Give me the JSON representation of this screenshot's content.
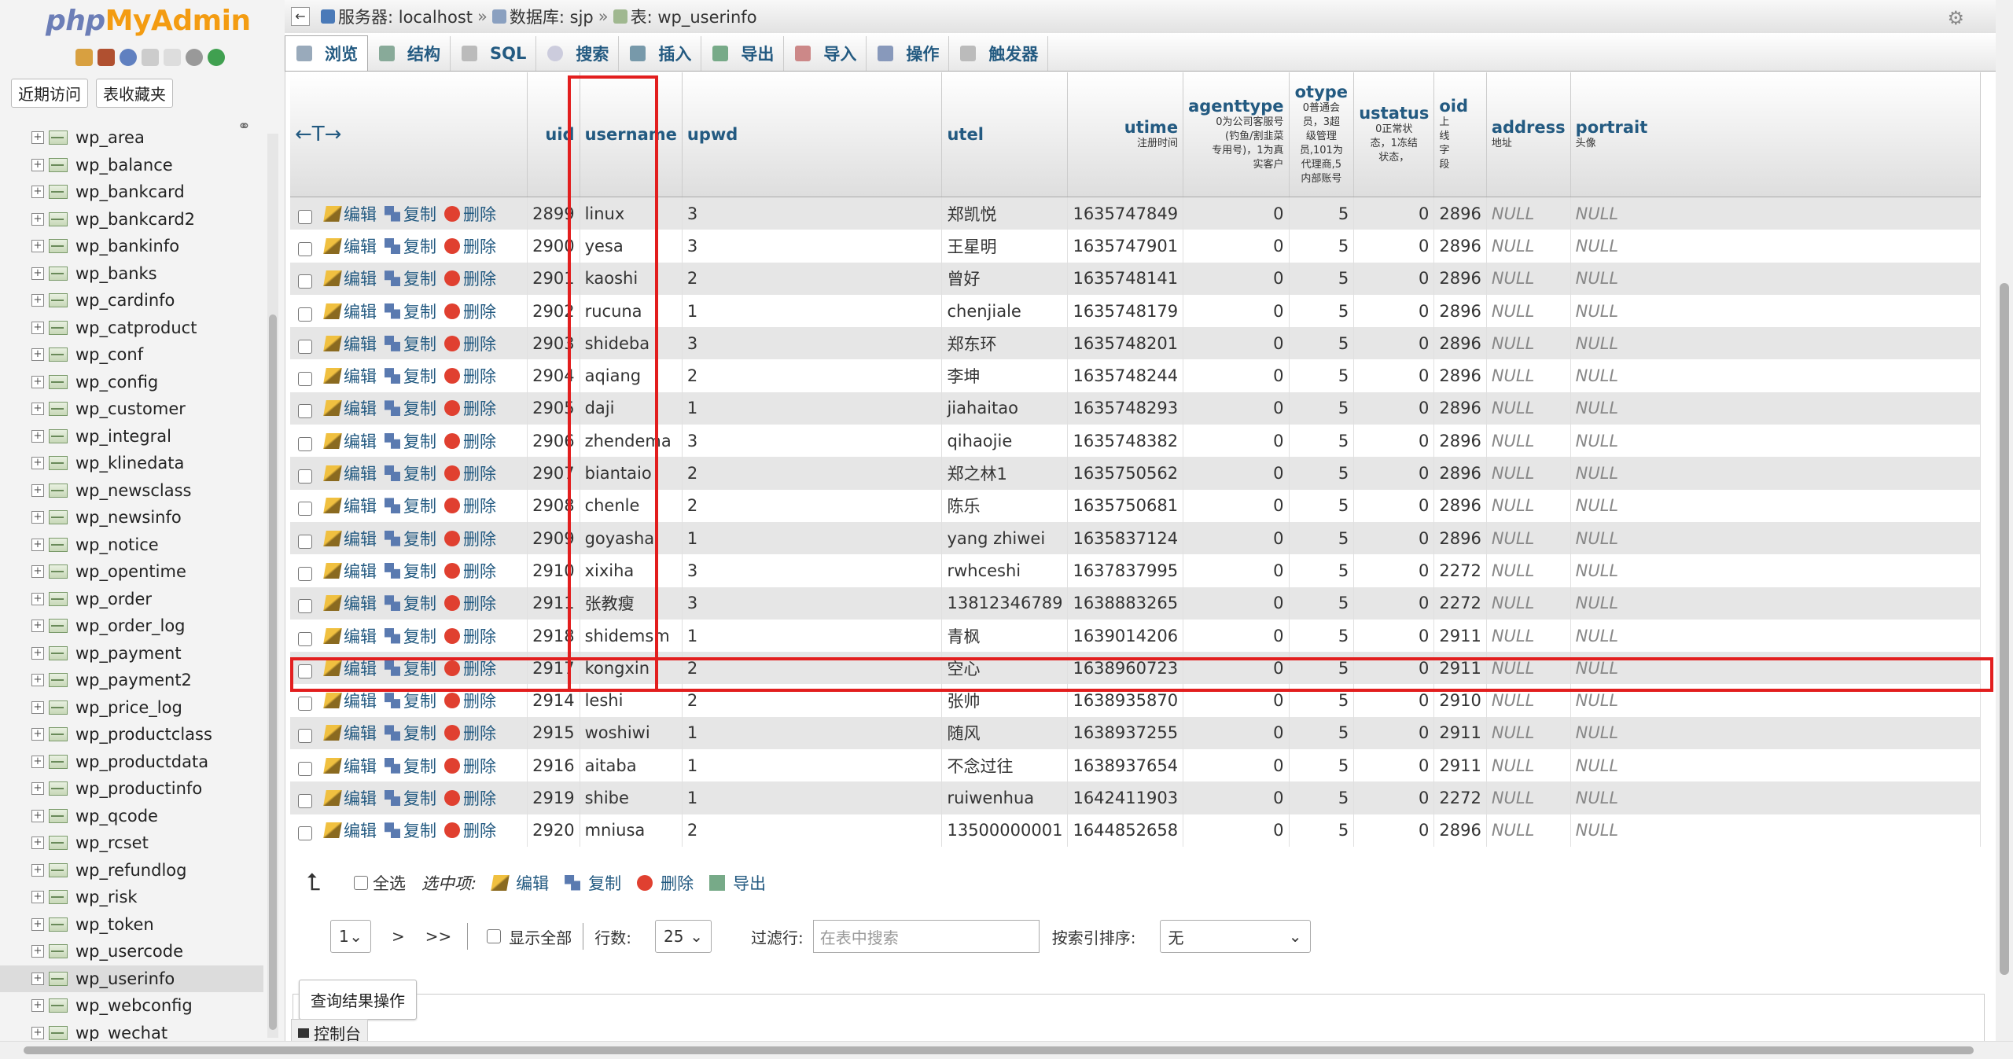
{
  "logo": {
    "php": "php",
    "my": "My",
    "admin": "Admin"
  },
  "sidebar": {
    "tabs": [
      "近期访问",
      "表收藏夹"
    ],
    "tables": [
      "wp_area",
      "wp_balance",
      "wp_bankcard",
      "wp_bankcard2",
      "wp_bankinfo",
      "wp_banks",
      "wp_cardinfo",
      "wp_catproduct",
      "wp_conf",
      "wp_config",
      "wp_customer",
      "wp_integral",
      "wp_klinedata",
      "wp_newsclass",
      "wp_newsinfo",
      "wp_notice",
      "wp_opentime",
      "wp_order",
      "wp_order_log",
      "wp_payment",
      "wp_payment2",
      "wp_price_log",
      "wp_productclass",
      "wp_productdata",
      "wp_productinfo",
      "wp_qcode",
      "wp_rcset",
      "wp_refundlog",
      "wp_risk",
      "wp_token",
      "wp_usercode",
      "wp_userinfo",
      "wp_webconfig",
      "wp_wechat"
    ],
    "active": "wp_userinfo"
  },
  "breadcrumb": {
    "server": "服务器: localhost",
    "db": "数据库: sjp",
    "table": "表: wp_userinfo"
  },
  "tabs": [
    "浏览",
    "结构",
    "SQL",
    "搜索",
    "插入",
    "导出",
    "导入",
    "操作",
    "触发器"
  ],
  "columns": {
    "uid": "uid",
    "username": "username",
    "upwd": "upwd",
    "utel": "utel",
    "utime": "utime",
    "utime_c": "注册时间",
    "agenttype": "agenttype",
    "agenttype_c": [
      "0为公司客服号",
      "(钓鱼/割韭菜",
      "专用号)，1为真",
      "实客户"
    ],
    "otype": "otype",
    "otype_c": [
      "0普通会",
      "员，3超",
      "级管理",
      "员,101为",
      "代理商,5",
      "内部账号"
    ],
    "ustatus": "ustatus",
    "ustatus_c": [
      "0正常状",
      "态，1冻结",
      "状态，"
    ],
    "oid": "oid",
    "oid_c": [
      "上",
      "线",
      "字",
      "段"
    ],
    "address": "address",
    "address_c": "地址",
    "portrait": "portrait",
    "portrait_c": "头像"
  },
  "actions": {
    "edit": "编辑",
    "copy": "复制",
    "delete": "删除"
  },
  "rows": [
    {
      "uid": "2899",
      "username": "linux",
      "upwd": "3",
      "utel": "郑凯悦",
      "utime": "1635747849",
      "agenttype": "0",
      "otype": "5",
      "ustatus": "0",
      "oid": "2896",
      "address": "NULL",
      "portrait": "NULL"
    },
    {
      "uid": "2900",
      "username": "yesa",
      "upwd": "3",
      "utel": "王星明",
      "utime": "1635747901",
      "agenttype": "0",
      "otype": "5",
      "ustatus": "0",
      "oid": "2896",
      "address": "NULL",
      "portrait": "NULL"
    },
    {
      "uid": "2901",
      "username": "kaoshi",
      "upwd": "2",
      "utel": "曾好",
      "utime": "1635748141",
      "agenttype": "0",
      "otype": "5",
      "ustatus": "0",
      "oid": "2896",
      "address": "NULL",
      "portrait": "NULL"
    },
    {
      "uid": "2902",
      "username": "rucuna",
      "upwd": "1",
      "utel": "chenjiale",
      "utime": "1635748179",
      "agenttype": "0",
      "otype": "5",
      "ustatus": "0",
      "oid": "2896",
      "address": "NULL",
      "portrait": "NULL"
    },
    {
      "uid": "2903",
      "username": "shideba",
      "upwd": "3",
      "utel": "郑东环",
      "utime": "1635748201",
      "agenttype": "0",
      "otype": "5",
      "ustatus": "0",
      "oid": "2896",
      "address": "NULL",
      "portrait": "NULL"
    },
    {
      "uid": "2904",
      "username": "aqiang",
      "upwd": "2",
      "utel": "李坤",
      "utime": "1635748244",
      "agenttype": "0",
      "otype": "5",
      "ustatus": "0",
      "oid": "2896",
      "address": "NULL",
      "portrait": "NULL"
    },
    {
      "uid": "2905",
      "username": "daji",
      "upwd": "1",
      "utel": "jiahaitao",
      "utime": "1635748293",
      "agenttype": "0",
      "otype": "5",
      "ustatus": "0",
      "oid": "2896",
      "address": "NULL",
      "portrait": "NULL"
    },
    {
      "uid": "2906",
      "username": "zhendema",
      "upwd": "3",
      "utel": "qihaojie",
      "utime": "1635748382",
      "agenttype": "0",
      "otype": "5",
      "ustatus": "0",
      "oid": "2896",
      "address": "NULL",
      "portrait": "NULL"
    },
    {
      "uid": "2907",
      "username": "biantaio",
      "upwd": "2",
      "utel": "郑之林1",
      "utime": "1635750562",
      "agenttype": "0",
      "otype": "5",
      "ustatus": "0",
      "oid": "2896",
      "address": "NULL",
      "portrait": "NULL"
    },
    {
      "uid": "2908",
      "username": "chenle",
      "upwd": "2",
      "utel": "陈乐",
      "utime": "1635750681",
      "agenttype": "0",
      "otype": "5",
      "ustatus": "0",
      "oid": "2896",
      "address": "NULL",
      "portrait": "NULL"
    },
    {
      "uid": "2909",
      "username": "goyasha",
      "upwd": "1",
      "utel": "yang zhiwei",
      "utime": "1635837124",
      "agenttype": "0",
      "otype": "5",
      "ustatus": "0",
      "oid": "2896",
      "address": "NULL",
      "portrait": "NULL"
    },
    {
      "uid": "2910",
      "username": "xixiha",
      "upwd": "3",
      "utel": "rwhceshi",
      "utime": "1637837995",
      "agenttype": "0",
      "otype": "5",
      "ustatus": "0",
      "oid": "2272",
      "address": "NULL",
      "portrait": "NULL"
    },
    {
      "uid": "2911",
      "username": "张教瘦",
      "upwd": "3",
      "utel": "13812346789",
      "utime": "1638883265",
      "agenttype": "0",
      "otype": "5",
      "ustatus": "0",
      "oid": "2272",
      "address": "NULL",
      "portrait": "NULL"
    },
    {
      "uid": "2918",
      "username": "shidemsm",
      "upwd": "1",
      "utel": "青枫",
      "utime": "1639014206",
      "agenttype": "0",
      "otype": "5",
      "ustatus": "0",
      "oid": "2911",
      "address": "NULL",
      "portrait": "NULL"
    },
    {
      "uid": "2917",
      "username": "kongxin",
      "upwd": "2",
      "utel": "空心",
      "utime": "1638960723",
      "agenttype": "0",
      "otype": "5",
      "ustatus": "0",
      "oid": "2911",
      "address": "NULL",
      "portrait": "NULL"
    },
    {
      "uid": "2914",
      "username": "leshi",
      "upwd": "2",
      "utel": "张帅",
      "utime": "1638935870",
      "agenttype": "0",
      "otype": "5",
      "ustatus": "0",
      "oid": "2910",
      "address": "NULL",
      "portrait": "NULL"
    },
    {
      "uid": "2915",
      "username": "woshiwi",
      "upwd": "1",
      "utel": "随风",
      "utime": "1638937255",
      "agenttype": "0",
      "otype": "5",
      "ustatus": "0",
      "oid": "2911",
      "address": "NULL",
      "portrait": "NULL"
    },
    {
      "uid": "2916",
      "username": "aitaba",
      "upwd": "1",
      "utel": "不念过往",
      "utime": "1638937654",
      "agenttype": "0",
      "otype": "5",
      "ustatus": "0",
      "oid": "2911",
      "address": "NULL",
      "portrait": "NULL"
    },
    {
      "uid": "2919",
      "username": "shibe",
      "upwd": "1",
      "utel": "ruiwenhua",
      "utime": "1642411903",
      "agenttype": "0",
      "otype": "5",
      "ustatus": "0",
      "oid": "2272",
      "address": "NULL",
      "portrait": "NULL"
    },
    {
      "uid": "2920",
      "username": "mniusa",
      "upwd": "2",
      "utel": "13500000001",
      "utime": "1644852658",
      "agenttype": "0",
      "otype": "5",
      "ustatus": "0",
      "oid": "2896",
      "address": "NULL",
      "portrait": "NULL"
    }
  ],
  "bulk": {
    "select_all": "全选",
    "with_selected": "选中项:",
    "edit": "编辑",
    "copy": "复制",
    "delete": "删除",
    "export": "导出"
  },
  "nav": {
    "page": "1",
    "next": ">",
    "last": ">>",
    "show_all": "显示全部",
    "rows_label": "行数:",
    "rows_value": "25",
    "filter_label": "过滤行:",
    "filter_placeholder": "在表中搜索",
    "sort_label": "按索引排序:",
    "sort_value": "无"
  },
  "query_results": "查询结果操作",
  "console": "控制台"
}
